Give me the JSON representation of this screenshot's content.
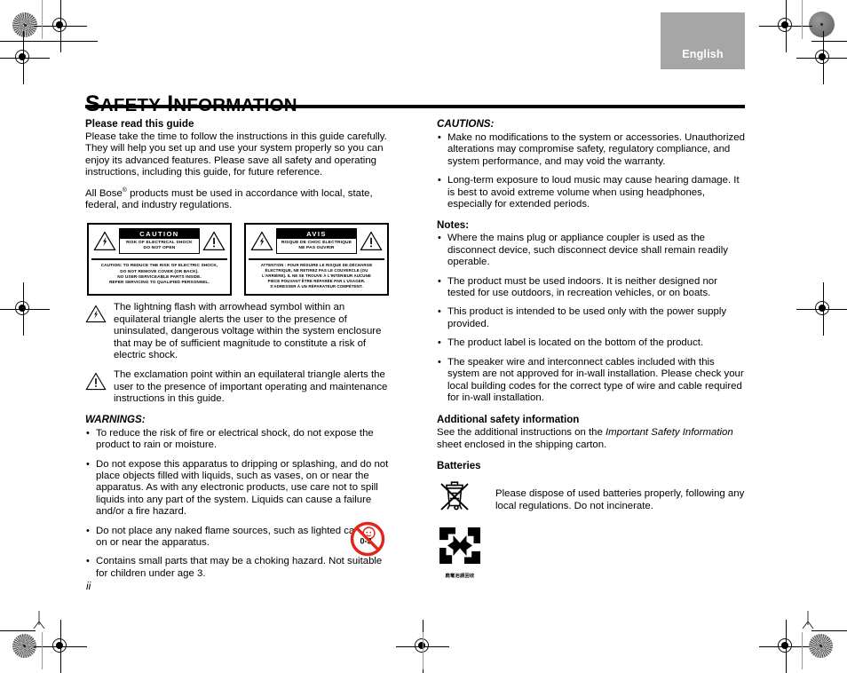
{
  "header": {
    "language_tab": "English",
    "tab_bg": "#a6a6a6"
  },
  "title": {
    "word1_cap": "S",
    "word1_rest": "AFETY",
    "word2_cap": "I",
    "word2_rest": "NFORMATION",
    "full": "SAFETY INFORMATION"
  },
  "left_column": {
    "please_read_heading": "Please read this guide",
    "please_read_body": "Please take the time to follow the instructions in this guide carefully. They will help you set up and use your system properly so you can enjoy its advanced features. Please save all safety and operating instructions, including this guide, for future reference.",
    "bose_regulations_pre": "All Bose",
    "bose_regulations_reg": "®",
    "bose_regulations_post": " products must be used in accordance with local, state, federal, and industry regulations.",
    "caution_box": {
      "banner": "CAUTION",
      "subtitle_line1": "RISK OF ELECTRICAL SHOCK",
      "subtitle_line2": "DO NOT OPEN",
      "bottom_line1": "CAUTION: TO REDUCE THE RISK OF ELECTRIC SHOCK,",
      "bottom_line2": "DO NOT REMOVE COVER (OR BACK).",
      "bottom_line3": "NO USER-SERVICEABLE PARTS INSIDE.",
      "bottom_line4": "REFER SERVICING TO QUALIFIED PERSONNEL."
    },
    "avis_box": {
      "banner": "AVIS",
      "subtitle_line1": "RISQUE DE CHOC ÉLECTRIQUE",
      "subtitle_line2": "NE PAS OUVRIR",
      "bottom_line1": "ATTENTION : POUR RÉDUIRE LE RISQUE DE DÉCHARGE",
      "bottom_line2": "ÉLECTRIQUE, NE RETIREZ PAS LE COUVERCLE (OU",
      "bottom_line3": "L'ARRIÈRE). IL NE SE TROUVE À L'INTÉRIEUR AUCUNE",
      "bottom_line4": "PIÈCE POUVANT ÊTRE RÉPARÉE PAR L'USAGER.",
      "bottom_line5": "S'ADRESSER À UN RÉPARATEUR COMPÉTENT."
    },
    "symbol_lightning": "The lightning flash with arrowhead symbol within an equilateral triangle alerts the user to the presence of uninsulated, dangerous voltage within the system enclosure that may be of sufficient magnitude to constitute a risk of electric shock.",
    "symbol_exclamation": "The exclamation point within an equilateral triangle alerts the user to the presence of important operating and maintenance instructions in this guide.",
    "warnings_heading": "WARNINGS:",
    "warnings": [
      "To reduce the risk of fire or electrical shock, do not expose the product to rain or moisture.",
      "Do not expose this apparatus to dripping or splashing, and do not place objects filled with liquids, such as vases, on or near the apparatus. As with any electronic products, use care not to spill liquids into any part of the system. Liquids can cause a failure and/or a fire hazard.",
      "Do not place any naked flame sources, such as lighted candles, on or near the apparatus.",
      "Contains small parts that may be a choking hazard. Not suitable for children under age 3."
    ],
    "choking_badge_label": "0-3",
    "choking_badge_color": "#e1251b"
  },
  "right_column": {
    "cautions_heading": "CAUTIONS:",
    "cautions": [
      "Make no modifications to the system or accessories. Unauthorized alterations may compromise safety, regulatory compliance, and system performance, and may void the warranty.",
      "Long-term exposure to loud music may cause hearing damage. It is best to avoid extreme volume when using headphones, especially for extended periods."
    ],
    "notes_heading": "Notes:",
    "notes": [
      "Where the mains plug or appliance coupler is used as the disconnect device, such disconnect device shall remain readily operable.",
      "The product must be used indoors. It is neither designed nor tested for use outdoors, in recreation vehicles, or on boats.",
      "This product is intended to be used only with the power supply provided.",
      "The product label is located on the bottom of the product.",
      "The speaker wire and interconnect cables included with this system are not approved for in-wall installation. Please check your local building codes for the correct type of wire and cable required for in-wall installation."
    ],
    "additional_heading": "Additional safety information",
    "additional_pre": "See the additional instructions on the ",
    "additional_italic": "Important Safety Information",
    "additional_post": " sheet enclosed in the shipping carton.",
    "batteries_heading": "Batteries",
    "batteries_body": "Please dispose of used batteries properly, following any local regulations. Do not incinerate.",
    "recycle_caption": "廃電池請回收"
  },
  "footer": {
    "page_number": "ii"
  }
}
